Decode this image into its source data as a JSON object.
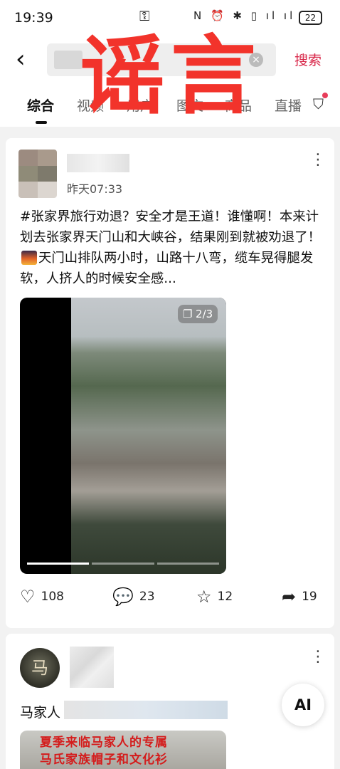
{
  "status_bar": {
    "time": "19:39",
    "key_icon": "key-icon",
    "indicators": "N ⏰ ✱ ▯ ıl ıl",
    "battery": "22"
  },
  "search": {
    "back_icon": "back-arrow-icon",
    "clear_icon": "×",
    "button_label": "搜索"
  },
  "tabs": {
    "items": [
      "综合",
      "视频",
      "用户",
      "图文",
      "商品",
      "直播"
    ],
    "active": "综合",
    "filter_icon": "filter-icon"
  },
  "stamp": {
    "text": "谣言",
    "color": "#f2332b"
  },
  "post": {
    "time": "昨天07:33",
    "text_before_emoji": "#张家界旅行劝退？安全才是王道！谁懂啊！本来计划去张家界天门山和大峡谷，结果刚到就被劝退了！",
    "text_after_emoji": "天门山排队两小时，山路十八弯，缆车晃得腿发软，人挤人的时候安全感...",
    "media_badge": "2/3",
    "likes": "108",
    "comments": "23",
    "favorites": "12",
    "shares": "19"
  },
  "post2": {
    "avatar_char": "马",
    "title_start": "马家人",
    "banner_line1": "夏季来临马家人的专属",
    "banner_line2": "马氏家族帽子和文化衫"
  },
  "ai_button": "AI",
  "colors": {
    "accent": "#d8284a",
    "stamp": "#f2332b"
  }
}
